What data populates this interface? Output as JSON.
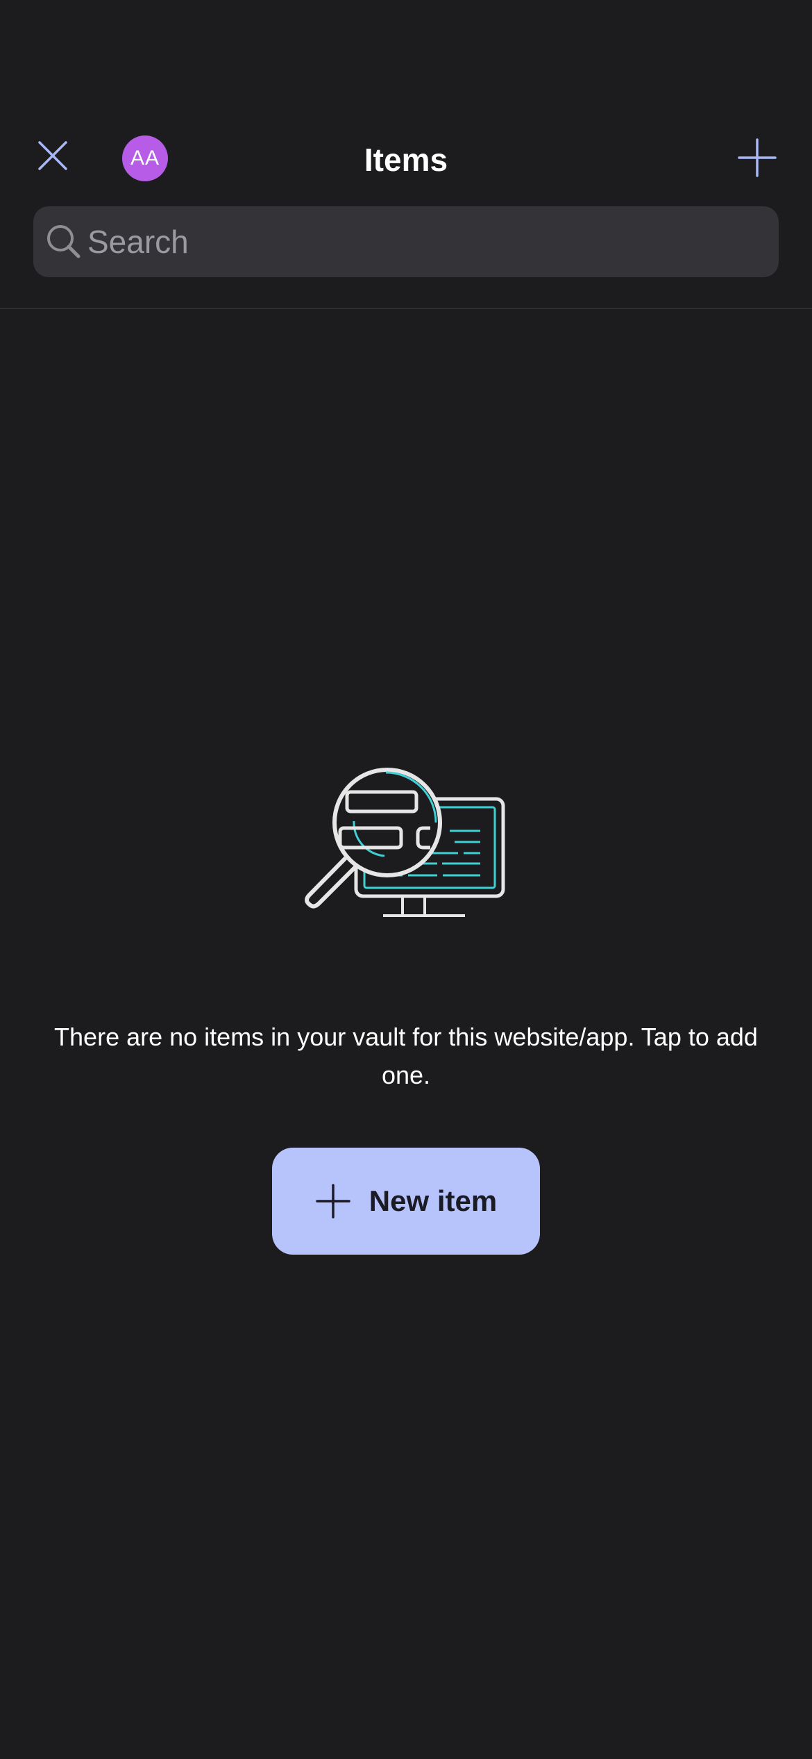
{
  "header": {
    "title": "Items",
    "avatar_initials": "AA",
    "avatar_color": "#b65ce6",
    "close_icon": "close-icon",
    "add_icon": "plus-icon",
    "accent_color": "#a8b8f8"
  },
  "search": {
    "placeholder": "Search",
    "value": "",
    "icon": "search-icon"
  },
  "empty_state": {
    "illustration": "magnifier-over-monitor-illustration",
    "message": "There are no items in your vault for this website/app. Tap to add one.",
    "button_label": "New item",
    "button_icon": "plus-icon",
    "button_color": "#b6c4fb"
  }
}
